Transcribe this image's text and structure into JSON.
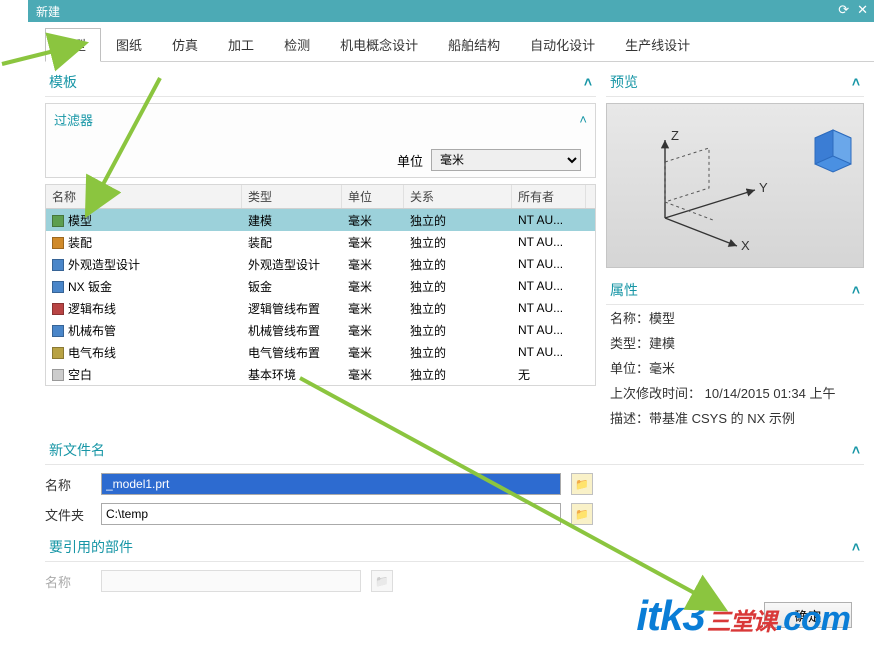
{
  "titlebar": {
    "title": "新建"
  },
  "tabs": [
    "模型",
    "图纸",
    "仿真",
    "加工",
    "检测",
    "机电概念设计",
    "船舶结构",
    "自动化设计",
    "生产线设计"
  ],
  "template_section": "模板",
  "filter_label": "过滤器",
  "unit_label": "单位",
  "unit_value": "毫米",
  "columns": {
    "name": "名称",
    "type": "类型",
    "unit": "单位",
    "rel": "关系",
    "owner": "所有者"
  },
  "rows": [
    {
      "name": "模型",
      "type": "建模",
      "unit": "毫米",
      "rel": "独立的",
      "owner": "NT AU..."
    },
    {
      "name": "装配",
      "type": "装配",
      "unit": "毫米",
      "rel": "独立的",
      "owner": "NT AU..."
    },
    {
      "name": "外观造型设计",
      "type": "外观造型设计",
      "unit": "毫米",
      "rel": "独立的",
      "owner": "NT AU..."
    },
    {
      "name": "NX 钣金",
      "type": "钣金",
      "unit": "毫米",
      "rel": "独立的",
      "owner": "NT AU..."
    },
    {
      "name": "逻辑布线",
      "type": "逻辑管线布置",
      "unit": "毫米",
      "rel": "独立的",
      "owner": "NT AU..."
    },
    {
      "name": "机械布管",
      "type": "机械管线布置",
      "unit": "毫米",
      "rel": "独立的",
      "owner": "NT AU..."
    },
    {
      "name": "电气布线",
      "type": "电气管线布置",
      "unit": "毫米",
      "rel": "独立的",
      "owner": "NT AU..."
    },
    {
      "name": "空白",
      "type": "基本环境",
      "unit": "毫米",
      "rel": "独立的",
      "owner": "无"
    }
  ],
  "preview_label": "预览",
  "props_label": "属性",
  "props": {
    "name_l": "名称：",
    "name_v": "模型",
    "type_l": "类型：",
    "type_v": "建模",
    "unit_l": "单位：",
    "unit_v": "毫米",
    "time_l": "上次修改时间：",
    "time_v": "10/14/2015 01:34 上午",
    "desc_l": "描述：",
    "desc_v": "带基准 CSYS 的 NX 示例"
  },
  "newfile_label": "新文件名",
  "name_field_label": "名称",
  "name_field_value": "_model1.prt",
  "folder_field_label": "文件夹",
  "folder_field_value": "C:\\temp",
  "ref_label": "要引用的部件",
  "ref_name_label": "名称",
  "confirm_btn": "确定",
  "watermark": {
    "a": "itk3",
    "b": "三堂课",
    "c": "com"
  }
}
